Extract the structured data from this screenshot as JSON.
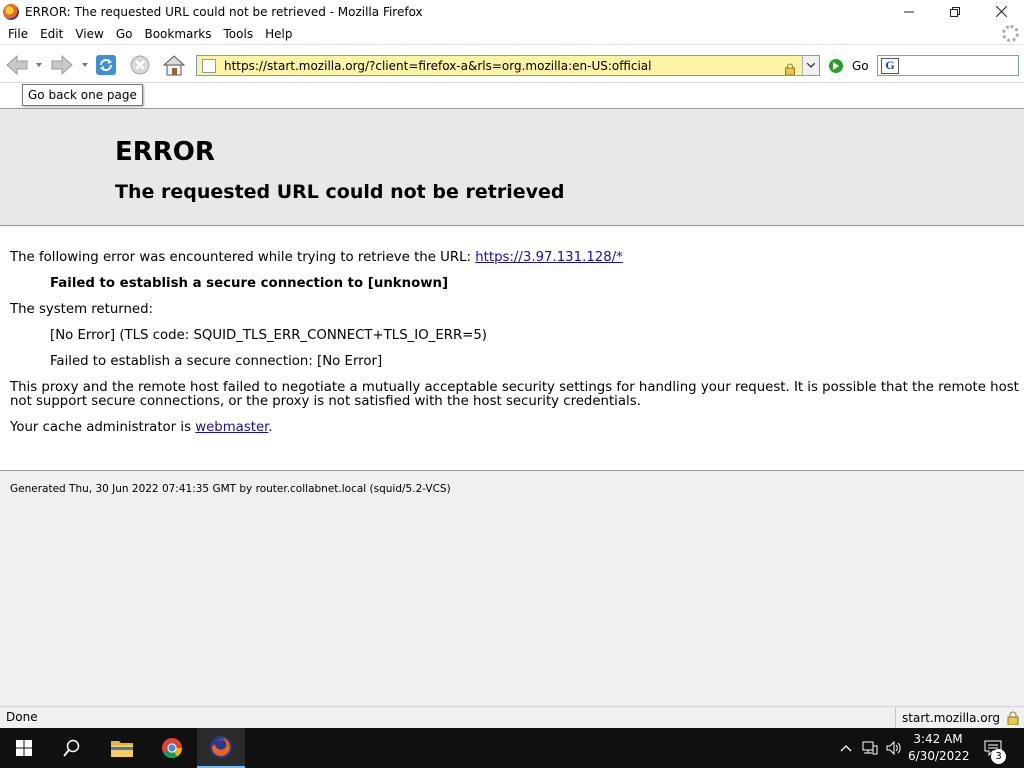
{
  "window": {
    "title": "ERROR: The requested URL could not be retrieved - Mozilla Firefox"
  },
  "menu": [
    "File",
    "Edit",
    "View",
    "Go",
    "Bookmarks",
    "Tools",
    "Help"
  ],
  "toolbar": {
    "url": "https://start.mozilla.org/?client=firefox-a&rls=org.mozilla:en-US:official",
    "go_label": "Go",
    "search_engine_letter": "G"
  },
  "tooltip": "Go back one page",
  "page": {
    "title": "ERROR",
    "subtitle": "The requested URL could not be retrieved",
    "line1_prefix": "The following error was encountered while trying to retrieve the URL: ",
    "line1_link": "https://3.97.131.128/*",
    "error_bold": "Failed to establish a secure connection to [unknown]",
    "system_returned": "The system returned:",
    "tls_code": "[No Error] (TLS code: SQUID_TLS_ERR_CONNECT+TLS_IO_ERR=5)",
    "failed_connection": "Failed to establish a secure connection: [No Error]",
    "paragraph_line1": "This proxy and the remote host failed to negotiate a mutually acceptable security settings for handling your request. It is possible that the remote host does",
    "paragraph_line2": "not support secure connections, or the proxy is not satisfied with the host security credentials.",
    "admin_prefix": "Your cache administrator is ",
    "admin_link": "webmaster",
    "admin_suffix": ".",
    "footer": "Generated Thu, 30 Jun 2022 07:41:35 GMT by router.collabnet.local (squid/5.2-VCS)"
  },
  "statusbar": {
    "status": "Done",
    "host": "start.mozilla.org"
  },
  "taskbar": {
    "time": "3:42 AM",
    "date": "6/30/2022",
    "notification_count": "3"
  },
  "colors": {
    "urlbar_bg": "#fbf4a5",
    "link": "#1a0dab",
    "taskbar_bg": "#101010",
    "active_underline": "#76b9ed"
  }
}
